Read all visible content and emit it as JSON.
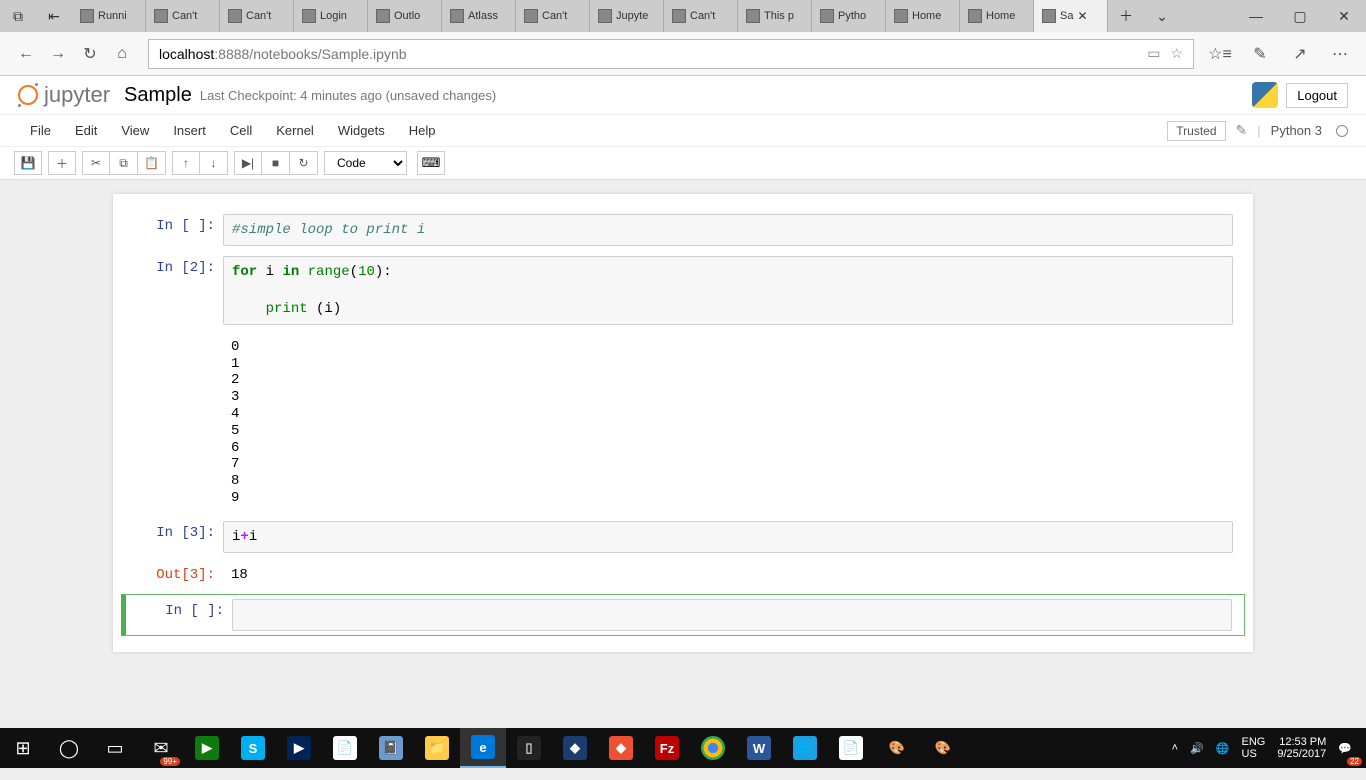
{
  "browser": {
    "tabs": [
      "Runni",
      "Can't",
      "Can't",
      "Login",
      "Outlo",
      "Atlass",
      "Can't",
      "Jupyte",
      "Can't",
      "This p",
      "Pytho",
      "Home",
      "Home",
      "Sa"
    ],
    "active_tab_index": 13,
    "url_host": "localhost",
    "url_path": ":8888/notebooks/Sample.ipynb"
  },
  "jupyter": {
    "logo_text": "jupyter",
    "title": "Sample",
    "checkpoint": "Last Checkpoint: 4 minutes ago (unsaved changes)",
    "logout": "Logout",
    "menu": [
      "File",
      "Edit",
      "View",
      "Insert",
      "Cell",
      "Kernel",
      "Widgets",
      "Help"
    ],
    "trusted": "Trusted",
    "kernel": "Python 3",
    "celltype": "Code"
  },
  "cells": [
    {
      "prompt_in": "In [ ]:",
      "code_html": "<span class='cm'>#simple loop to print i</span>"
    },
    {
      "prompt_in": "In [2]:",
      "code_html": "<span class='kw'>for</span> i <span class='kw'>in</span> <span class='bi'>range</span>(<span class='num'>10</span>):<br><br>&nbsp;&nbsp;&nbsp;&nbsp;<span class='bi'>print</span> (i)",
      "output": "0\n1\n2\n3\n4\n5\n6\n7\n8\n9"
    },
    {
      "prompt_in": "In [3]:",
      "code_html": "i<span class='op'>+</span>i",
      "prompt_out": "Out[3]:",
      "out_value": "18"
    },
    {
      "prompt_in": "In [ ]:",
      "code_html": "&nbsp;",
      "active": true
    }
  ],
  "taskbar": {
    "lang1": "ENG",
    "lang2": "US",
    "time": "12:53 PM",
    "date": "9/25/2017",
    "mail_badge": "99+",
    "action_badge": "22"
  }
}
